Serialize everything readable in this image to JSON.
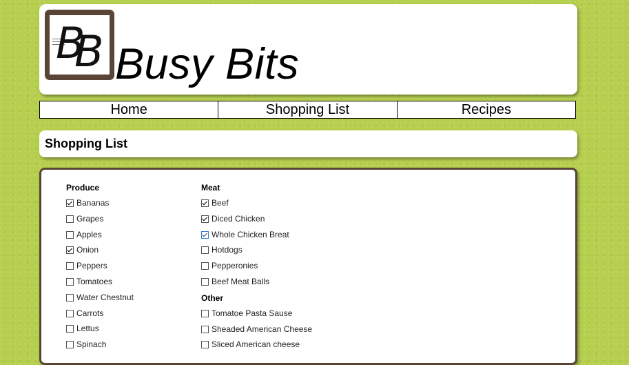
{
  "site": {
    "title": "Busy Bits",
    "logo_text": "BB"
  },
  "nav": {
    "items": [
      "Home",
      "Shopping List",
      "Recipes"
    ]
  },
  "page": {
    "title": "Shopping List"
  },
  "list": {
    "produce": {
      "heading": "Produce",
      "items": [
        {
          "label": "Bananas",
          "checked": true
        },
        {
          "label": "Grapes",
          "checked": false
        },
        {
          "label": "Apples",
          "checked": false
        },
        {
          "label": "Onion",
          "checked": true
        },
        {
          "label": "Peppers",
          "checked": false
        },
        {
          "label": "Tomatoes",
          "checked": false
        },
        {
          "label": "Water Chestnut",
          "checked": false
        },
        {
          "label": "Carrots",
          "checked": false
        },
        {
          "label": "Lettus",
          "checked": false
        },
        {
          "label": "Spinach",
          "checked": false
        }
      ]
    },
    "meat": {
      "heading": "Meat",
      "items": [
        {
          "label": "Beef",
          "checked": true
        },
        {
          "label": "Diced Chicken",
          "checked": true
        },
        {
          "label": "Whole Chicken Breat",
          "checked": true
        },
        {
          "label": "Hotdogs",
          "checked": false
        },
        {
          "label": "Pepperonies",
          "checked": false
        },
        {
          "label": "Beef Meat Balls",
          "checked": false
        }
      ]
    },
    "other": {
      "heading": "Other",
      "items": [
        {
          "label": "Tomatoe Pasta Sause",
          "checked": false
        },
        {
          "label": "Sheaded American Cheese",
          "checked": false
        },
        {
          "label": "Sliced American cheese",
          "checked": false
        }
      ]
    }
  },
  "colors": {
    "background": "#b6cf4e",
    "frame_brown": "#5a4436"
  }
}
